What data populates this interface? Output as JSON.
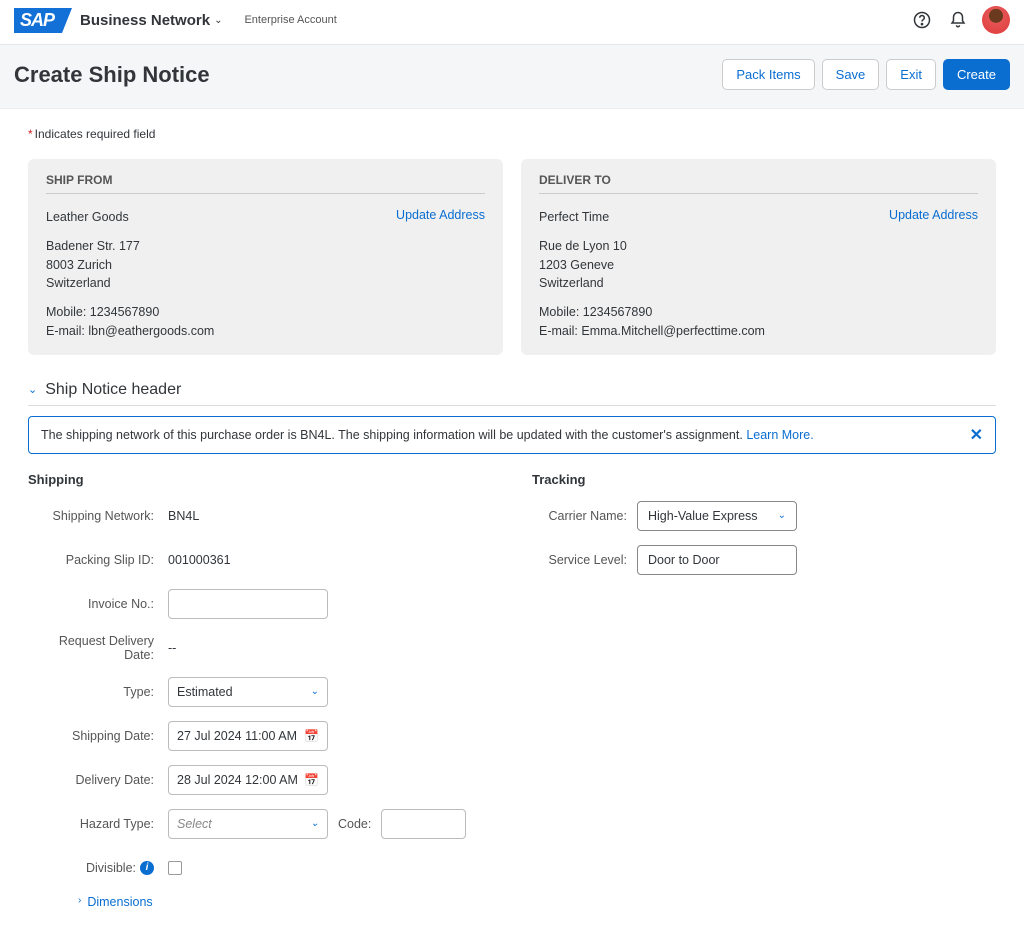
{
  "header": {
    "brand": "Business Network",
    "account_type": "Enterprise Account"
  },
  "page": {
    "title": "Create Ship Notice",
    "buttons": {
      "pack": "Pack Items",
      "save": "Save",
      "exit": "Exit",
      "create": "Create"
    },
    "required_note": "Indicates required field"
  },
  "ship_from": {
    "heading": "SHIP FROM",
    "name": "Leather Goods",
    "addr1": "Badener Str. 177",
    "addr2": "8003 Zurich",
    "country": "Switzerland",
    "mobile": "Mobile: 1234567890",
    "email": "E-mail: lbn@eathergoods.com",
    "update": "Update Address"
  },
  "deliver_to": {
    "heading": "DELIVER TO",
    "name": "Perfect Time",
    "addr1": "Rue de Lyon 10",
    "addr2": "1203 Geneve",
    "country": "Switzerland",
    "mobile": "Mobile: 1234567890",
    "email": "E-mail: Emma.Mitchell@perfecttime.com",
    "update": "Update Address"
  },
  "section": {
    "title": "Ship Notice header"
  },
  "banner": {
    "text": "The shipping network of this purchase order is BN4L. The shipping information will be updated with the customer's assignment.",
    "learn": "Learn More."
  },
  "shipping": {
    "heading": "Shipping",
    "network_label": "Shipping Network:",
    "network_value": "BN4L",
    "packing_label": "Packing Slip ID:",
    "packing_value": "001000361",
    "invoice_label": "Invoice No.:",
    "invoice_value": "",
    "req_date_label": "Request Delivery Date:",
    "req_date_value": "--",
    "type_label": "Type:",
    "type_value": "Estimated",
    "ship_date_label": "Shipping Date:",
    "ship_date_value": "27 Jul 2024 11:00 AM",
    "deliv_date_label": "Delivery Date:",
    "deliv_date_value": "28 Jul 2024 12:00 AM",
    "hazard_label": "Hazard Type:",
    "hazard_placeholder": "Select",
    "code_label": "Code:",
    "code_value": "",
    "divisible_label": "Divisible:",
    "dimensions_link": "Dimensions"
  },
  "tracking": {
    "heading": "Tracking",
    "carrier_label": "Carrier Name:",
    "carrier_value": "High-Value Express",
    "service_label": "Service Level:",
    "service_value": "Door to Door"
  }
}
